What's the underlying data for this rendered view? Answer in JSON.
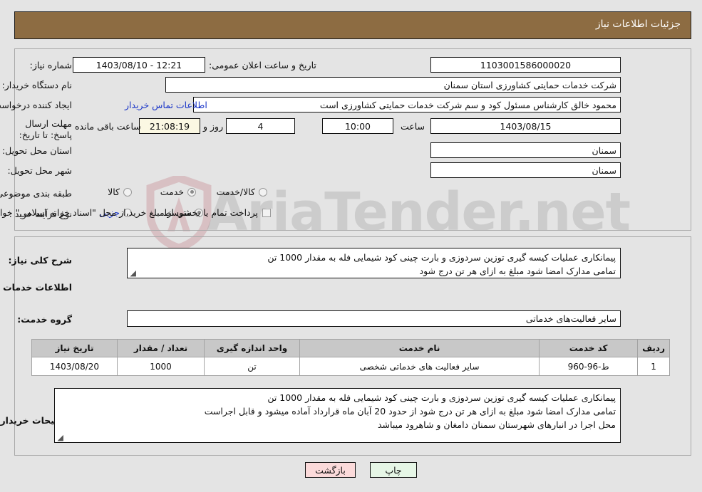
{
  "header": {
    "title": "جزئیات اطلاعات نیاز"
  },
  "form": {
    "need_number_label": "شماره نیاز:",
    "need_number_value": "1103001586000020",
    "announce_datetime_label": "تاریخ و ساعت اعلان عمومی:",
    "announce_datetime_value": "1403/08/10 - 12:21",
    "buyer_org_label": "نام دستگاه خریدار:",
    "buyer_org_value": "شرکت خدمات حمایتی کشاورزی استان سمنان",
    "requester_label": "ایجاد کننده درخواست:",
    "requester_value": "محمود خالق کارشناس مسئول کود و سم شرکت خدمات حمایتی کشاورزی است",
    "contact_link": "اطلاعات تماس خریدار",
    "deadline_label": "مهلت ارسال پاسخ: تا تاریخ:",
    "deadline_date": "1403/08/15",
    "hour_label": "ساعت",
    "hour_value": "10:00",
    "days_value": "4",
    "days_and_label": "روز و",
    "countdown_value": "21:08:19",
    "remaining_label": "ساعت باقی مانده",
    "province_label": "استان محل تحویل:",
    "province_value": "سمنان",
    "city_label": "شهر محل تحویل:",
    "city_value": "سمنان",
    "category_label": "طبقه بندی موضوعی:",
    "category_options": [
      {
        "label": "کالا",
        "selected": false
      },
      {
        "label": "خدمت",
        "selected": true
      },
      {
        "label": "کالا/خدمت",
        "selected": false
      }
    ],
    "process_label": "نوع فرآیند خرید :",
    "process_options": [
      {
        "label": "جزیی",
        "selected": false
      },
      {
        "label": "متوسط",
        "selected": true
      }
    ],
    "treasury_checkbox_label": "پرداخت تمام یا بخشی از مبلغ خرید،از محل \"اسناد خزانه اسلامی\" خواهد بود.",
    "treasury_checked": false
  },
  "description": {
    "label": "شرح کلی نیاز:",
    "line1": "پیمانکاری عملیات کیسه گیری توزین سردوزی و بارت چینی کود شیمایی فله به مقدار 1000 تن",
    "line2": "تمامی مدارک امضا شود مبلغ به ازای هر تن درج شود"
  },
  "services_section": {
    "heading": "اطلاعات خدمات مورد نیاز",
    "group_label": "گروه خدمت:",
    "group_value": "سایر فعالیت‌های خدماتی"
  },
  "table": {
    "columns": [
      "ردیف",
      "کد خدمت",
      "نام خدمت",
      "واحد اندازه گیری",
      "تعداد / مقدار",
      "تاریخ نیاز"
    ],
    "rows": [
      {
        "row_no": "1",
        "service_code": "ط-96-960",
        "service_name": "سایر فعالیت های خدماتی شخصی",
        "unit": "تن",
        "quantity": "1000",
        "need_date": "1403/08/20"
      }
    ]
  },
  "buyer_notes": {
    "label": "توضیحات خریدار:",
    "line1": "پیمانکاری عملیات کیسه گیری توزین سردوزی و بارت چینی کود شیمایی فله به مقدار 1000 تن",
    "line2": "تمامی مدارک امضا شود مبلغ به ازای هر تن درج شود از حدود 20 آبان ماه قرارداد آماده میشود و قابل اجراست",
    "line3": "محل اجرا در انبارهای شهرستان سمنان دامغان و شاهرود میباشد"
  },
  "footer": {
    "print_label": "چاپ",
    "back_label": "بازگشت"
  },
  "watermark": {
    "text": "AriaTender.net"
  },
  "colors": {
    "header_bg": "#8d6c42",
    "link": "#1b36c8",
    "print_btn": "#e6f6e6",
    "back_btn": "#fbdada",
    "table_header": "#c8c8c8",
    "page_bg": "#e4e4e4",
    "cream_field": "#fbf8e3"
  }
}
